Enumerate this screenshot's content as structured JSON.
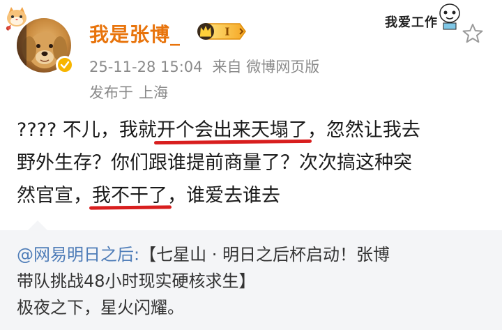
{
  "post": {
    "username": "我是张博_",
    "vip_level": "I",
    "timestamp": "25-11-28 15:04",
    "source": "来自 微博网页版",
    "location_prefix": "发布于",
    "location": "上海",
    "sticker_text": "我爱工作",
    "body": {
      "line1_a": "???? 不儿，我就",
      "line1_b": "开个会出来天塌了",
      "line1_c": "，忽然让我去",
      "line2": "野外生存？你们跟谁提前商量了？次次搞这种突",
      "line3_a": "然官宣，",
      "line3_b": "我不干了",
      "line3_c": "，谁爱去谁去"
    }
  },
  "repost": {
    "mention": "@网易明日之后",
    "colon": ":",
    "line1_rest": "【七星山 · 明日之后杯启动！张博",
    "line2": "带队挑战48小时现实硬核求生】",
    "line3": "极夜之下，星火闪耀。"
  },
  "colors": {
    "username": "#e8740c",
    "meta": "#8a8a8a",
    "mention": "#4f7db8",
    "underline": "#d81e1e",
    "repost_bg": "#f4f5f7",
    "verify": "#f7b500"
  },
  "icons": {
    "avatar": "golden-retriever-avatar",
    "verify": "verified-badge-icon",
    "vip": "crown-icon",
    "star": "star-icon",
    "cat": "cat-icon"
  }
}
